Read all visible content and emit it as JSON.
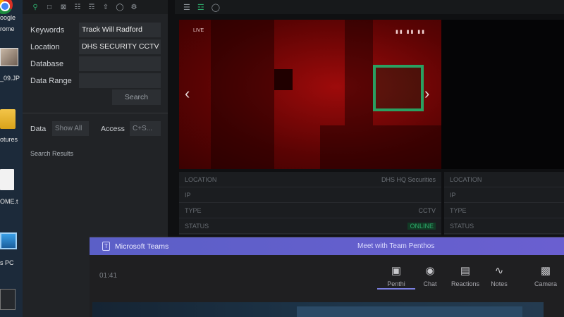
{
  "desktop": {
    "icons": [
      {
        "label_1": "oogle",
        "label_2": "rome",
        "icon": "chrome-icon"
      },
      {
        "label_1": "_09.JP",
        "icon": "image-file-icon"
      },
      {
        "label_1": "otures",
        "icon": "pictures-folder-icon"
      },
      {
        "label_1": "OME.t",
        "icon": "text-file-icon"
      },
      {
        "label_1": "s PC",
        "icon": "this-pc-icon"
      },
      {
        "label_1": "",
        "icon": "recycle-bin-icon"
      }
    ]
  },
  "search_panel": {
    "toolbar_icons": [
      "search-icon",
      "folder-icon",
      "close-box-icon",
      "network-icon",
      "hierarchy-icon",
      "upload-icon",
      "globe-icon",
      "settings-icon"
    ],
    "fields": [
      {
        "label": "Keywords",
        "value": "Track Will Radford"
      },
      {
        "label": "Location",
        "value": "DHS SECURITY CCTV"
      },
      {
        "label": "Database",
        "value": ""
      },
      {
        "label": "Data Range",
        "value": ""
      }
    ],
    "search_button": "Search",
    "data_label": "Data",
    "data_value": "Show All",
    "access_label": "Access",
    "access_value": "C+S...",
    "results_label": "Search Results"
  },
  "viewer": {
    "toolbar_icons": [
      "menu-icon",
      "list-icon",
      "globe-icon"
    ],
    "overlay_left": "LIVE",
    "overlay_right": "▮▮ ▮▮ ▮▮",
    "arrow_left": "‹",
    "arrow_right": "›",
    "info_primary": [
      {
        "key": "LOCATION",
        "value": "DHS HQ Securities"
      },
      {
        "key": "IP",
        "value": ""
      },
      {
        "key": "TYPE",
        "value": "CCTV"
      },
      {
        "key": "STATUS",
        "value": "ONLINE"
      }
    ],
    "info_secondary": [
      {
        "key": "LOCATION",
        "value": ""
      },
      {
        "key": "IP",
        "value": ""
      },
      {
        "key": "TYPE",
        "value": ""
      },
      {
        "key": "STATUS",
        "value": ""
      }
    ]
  },
  "teams": {
    "app_name": "Microsoft Teams",
    "meeting_title": "Meet with Team Penthos",
    "timer": "01:41",
    "buttons": [
      {
        "label": "Penthi",
        "icon": "video-camera-icon"
      },
      {
        "label": "Chat",
        "icon": "chat-icon"
      },
      {
        "label": "Reactions",
        "icon": "reactions-icon"
      },
      {
        "label": "Notes",
        "icon": "notes-icon"
      },
      {
        "label": "Camera",
        "icon": "camera-icon"
      }
    ]
  }
}
